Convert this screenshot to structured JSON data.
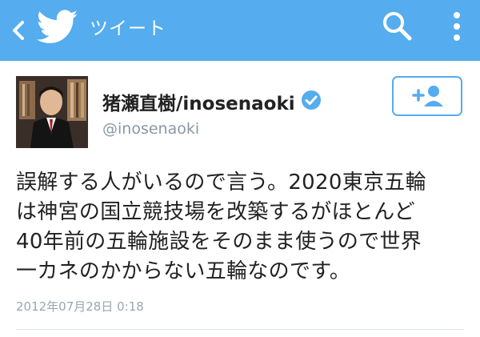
{
  "header": {
    "title": "ツイート",
    "icons": [
      "back-chevron-icon",
      "twitter-bird-icon",
      "search-icon",
      "more-vertical-icon"
    ]
  },
  "tweet": {
    "author_name": "猪瀬直樹/inosenaoki",
    "handle": "@inosenaoki",
    "verified": true,
    "follow_icon": "add-user-icon",
    "text_lines": [
      "誤解する人がいるので言う。2020東京五輪",
      "は神宮の国立競技場を改築するがほとんど",
      "40年前の五輪施設をそのまま使うので世界",
      "一カネのかからない五輪なのです。"
    ],
    "timestamp": "2012年07月28日 0:18"
  },
  "colors": {
    "header_bg": "#55acee",
    "accent": "#55acee",
    "verified": "#55acee",
    "secondary_text": "#8899a6"
  }
}
